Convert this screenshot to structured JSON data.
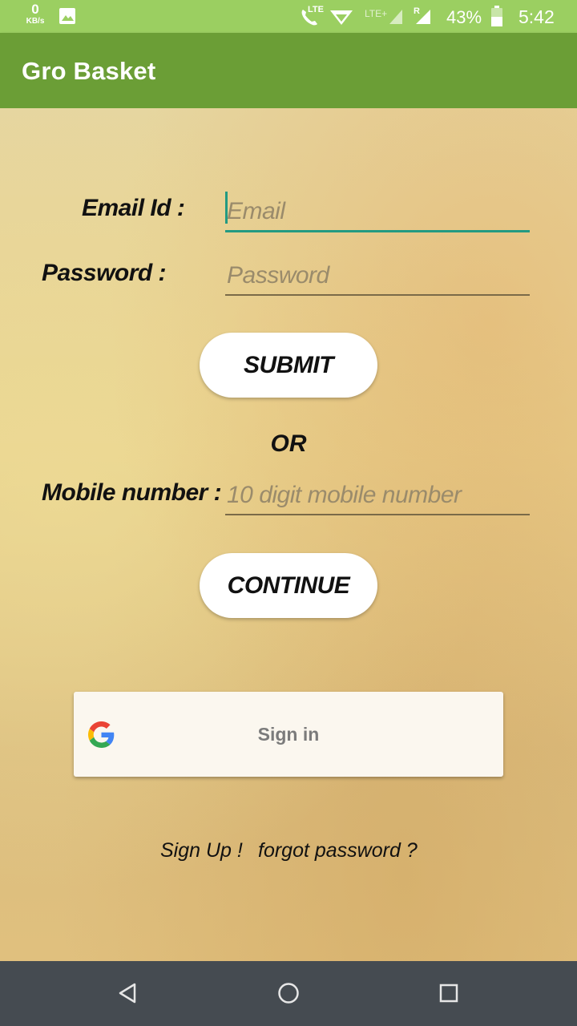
{
  "status_bar": {
    "speed_value": "0",
    "speed_unit": "KB/s",
    "lte_label": "LTE",
    "lte2_label": "LTE+",
    "roaming": "R",
    "battery": "43%",
    "time": "5:42"
  },
  "app_bar": {
    "title": "Gro Basket"
  },
  "form": {
    "email_label": "Email Id :",
    "email_placeholder": "Email",
    "password_label": "Password :",
    "password_placeholder": "Password",
    "submit_label": "SUBMIT",
    "or_label": "OR",
    "mobile_label": "Mobile number :",
    "mobile_placeholder": "10 digit mobile number",
    "continue_label": "CONTINUE"
  },
  "google_signin": {
    "label": "Sign in"
  },
  "links": {
    "sign_up": "Sign Up !",
    "forgot_password": "forgot password ?"
  },
  "colors": {
    "app_bar": "#6b9e36",
    "status_bar": "#9bcf61",
    "accent": "#239a82",
    "nav_bar": "#454b51"
  },
  "icons": [
    "image-icon",
    "volte-call-icon",
    "wifi-icon",
    "signal-icon",
    "battery-icon",
    "google-icon",
    "back-icon",
    "home-icon",
    "recents-icon"
  ]
}
